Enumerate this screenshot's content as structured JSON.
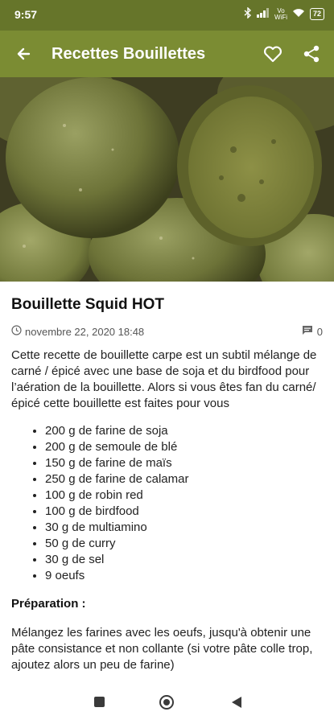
{
  "status_bar": {
    "time": "9:57",
    "icons": [
      "bluetooth-icon",
      "signal-icon",
      "volte-icon",
      "wifi-icon",
      "battery-icon"
    ],
    "volte_label": "Vo\nWiFi",
    "battery": "72"
  },
  "app_bar": {
    "title": "Recettes Bouillettes",
    "color": "#7b8c33",
    "status_color": "#66752a"
  },
  "post": {
    "title": "Bouillette Squid HOT",
    "date": "novembre 22, 2020 18:48",
    "comments": "0",
    "intro": "Cette recette de bouillette carpe est un subtil mélange de carné / épicé avec une base de soja et du birdfood pour l’aération de la bouillette. Alors si vous êtes fan du carné/épicé cette bouillette est faites pour vous",
    "ingredients": [
      "200 g de farine de soja",
      "200 g de semoule de blé",
      "150 g de farine de maïs",
      "250 g de farine de calamar",
      "100 g de robin red",
      "100 g de birdfood",
      "30 g de multiamino",
      "50 g de curry",
      "30 g de sel",
      "9 oeufs"
    ],
    "prep_heading": "Préparation :",
    "prep_text": "Mélangez les farines avec les oeufs, jusqu'à obtenir une pâte consistance et non collante (si votre pâte colle trop, ajoutez alors un peu de farine)"
  }
}
